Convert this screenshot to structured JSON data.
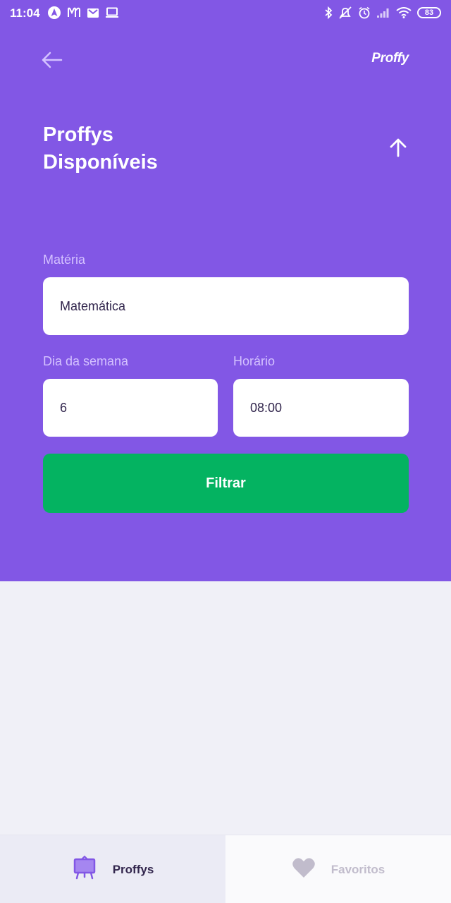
{
  "status_bar": {
    "time": "11:04",
    "battery": "83",
    "left_icons": [
      "navigation-icon",
      "pattern-icon",
      "gmail-icon",
      "laptop-icon"
    ],
    "right_icons": [
      "bluetooth-icon",
      "mute-icon",
      "alarm-icon",
      "signal-icon",
      "wifi-icon"
    ]
  },
  "topbar": {
    "back_icon": "arrow-left-icon",
    "logo": "Proffy"
  },
  "header": {
    "title_line1": "Proffys",
    "title_line2": "Disponíveis",
    "toggle_icon": "arrow-up-icon"
  },
  "filters": {
    "subject_label": "Matéria",
    "subject_value": "Matemática",
    "weekday_label": "Dia da semana",
    "weekday_value": "6",
    "time_label": "Horário",
    "time_value": "08:00",
    "submit_label": "Filtrar"
  },
  "tabs": [
    {
      "label": "Proffys",
      "icon": "easel-icon",
      "active": true
    },
    {
      "label": "Favoritos",
      "icon": "heart-icon",
      "active": false
    }
  ],
  "colors": {
    "primary": "#8257E5",
    "secondary": "#04B361",
    "background": "#F0F0F7",
    "label": "#D4C2FF",
    "tab_active_text": "#32264D",
    "tab_inactive_text": "#C1BCCC"
  }
}
